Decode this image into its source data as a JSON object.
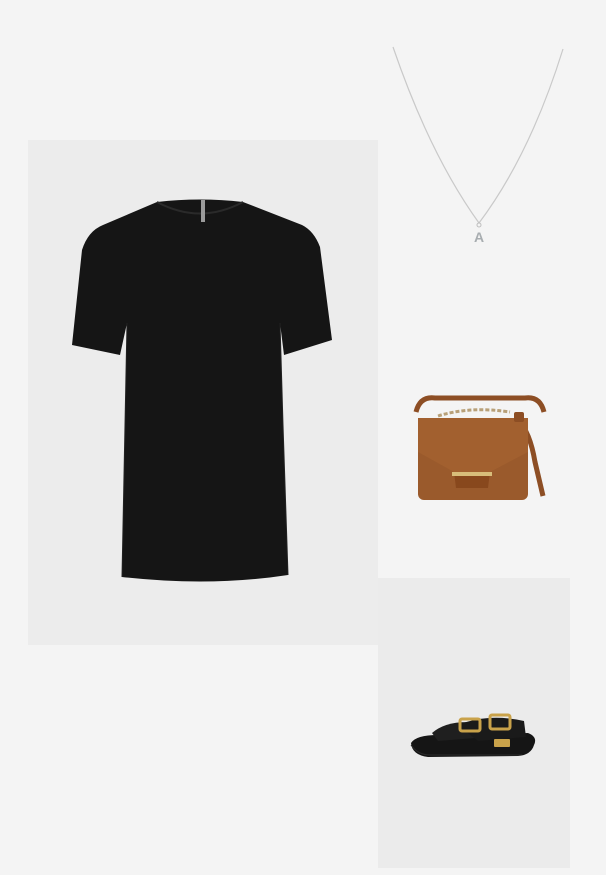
{
  "outfit": {
    "items": [
      {
        "kind": "dress",
        "icon": "black-tshirt-dress-icon",
        "color": "#141414"
      },
      {
        "kind": "necklace",
        "icon": "initial-pendant-necklace-icon",
        "color": "#c9c9c9",
        "pendant_letter": "A"
      },
      {
        "kind": "handbag",
        "icon": "tan-crossbody-bag-icon",
        "color": "#9a5a2c"
      },
      {
        "kind": "sandals",
        "icon": "black-buckle-sandals-icon",
        "color": "#151515",
        "hardware": "#c9a24a"
      }
    ],
    "colors": {
      "background": "#f4f4f4",
      "panel": "#ececec"
    }
  }
}
